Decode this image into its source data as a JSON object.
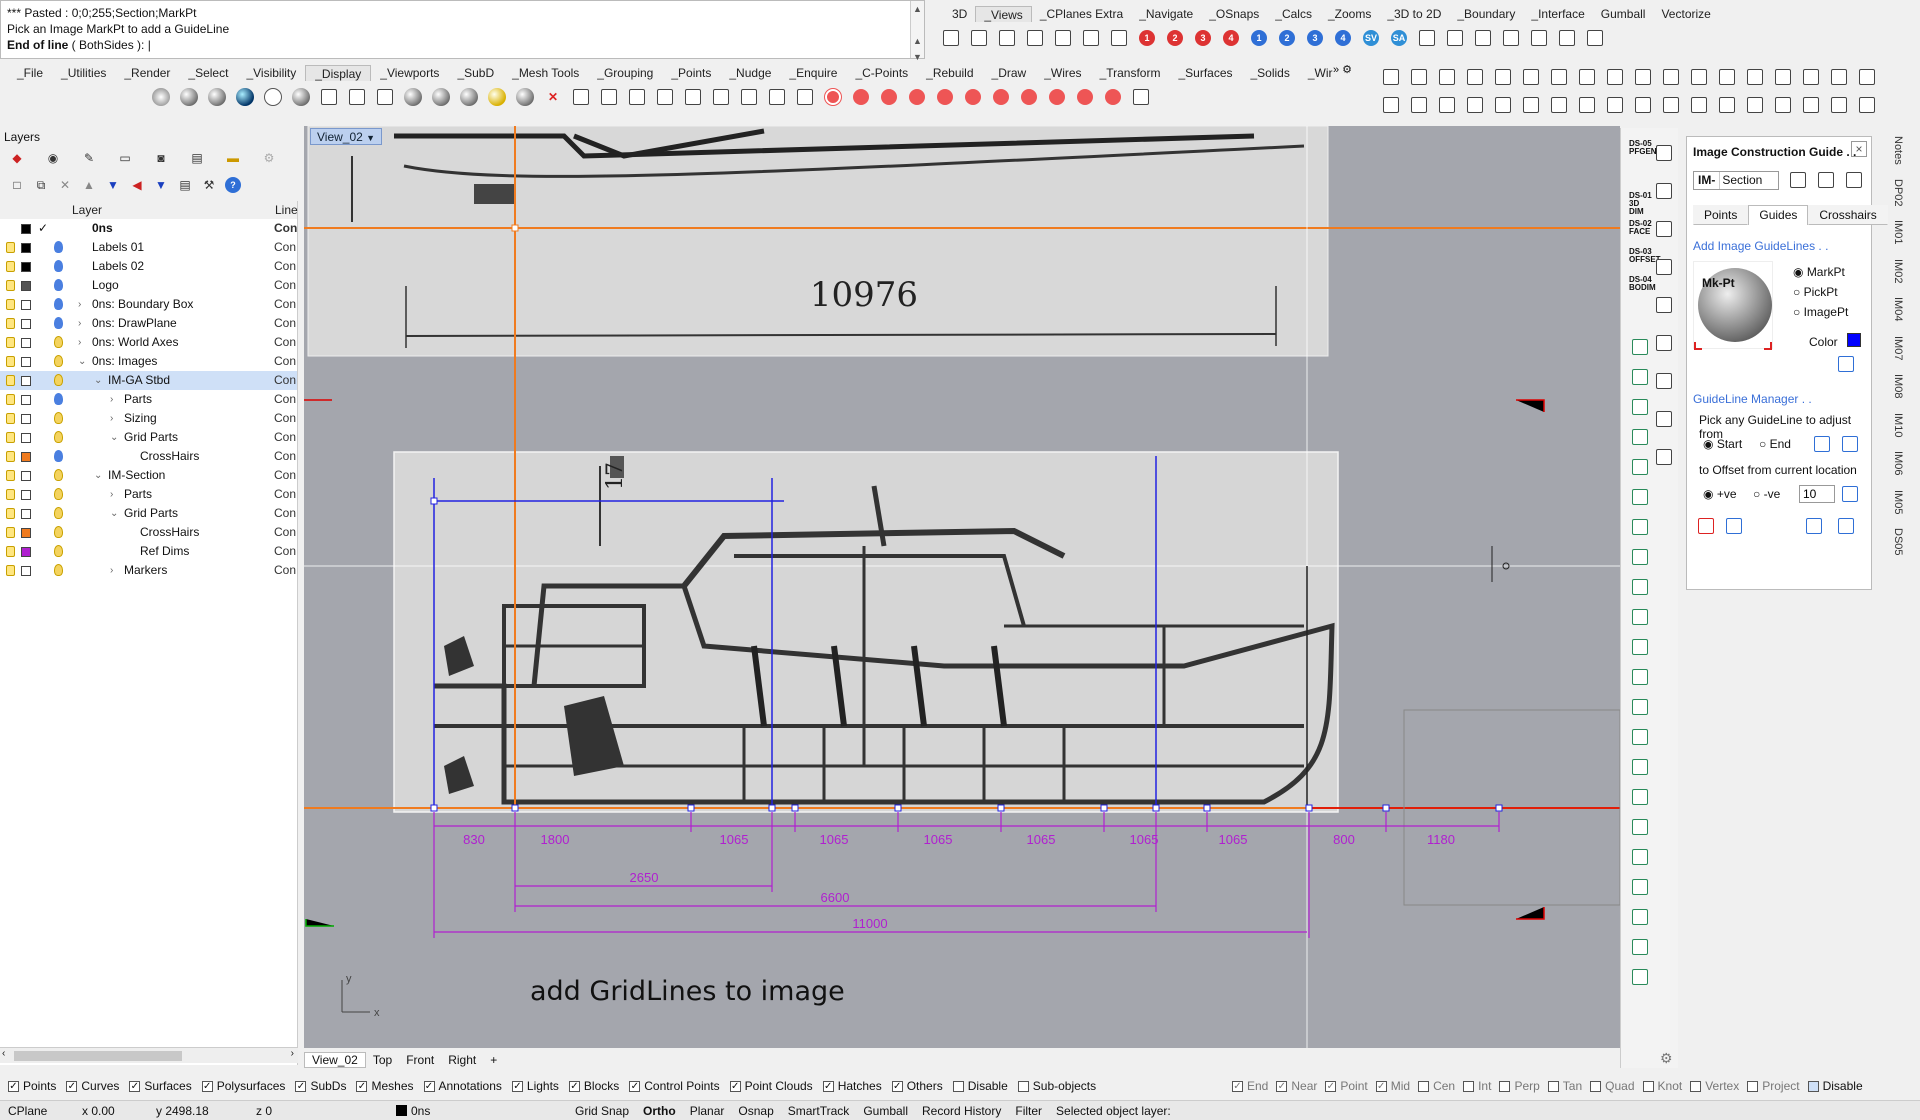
{
  "command": {
    "line1": "*** Pasted : 0;0;255;Section;MarkPt",
    "line2": "Pick an Image MarkPt to add a GuideLine",
    "line3_bold": "End of line",
    "line3_rest": " ( BothSides ):"
  },
  "top_tabs": [
    "3D",
    "_Views",
    "_CPlanes Extra",
    "_Navigate",
    "_OSnaps",
    "_Calcs",
    "_Zooms",
    "_3D to 2D",
    "_Boundary",
    "_Interface",
    "Gumball",
    "Vectorize"
  ],
  "main_tabs": [
    "_File",
    "_Utilities",
    "_Render",
    "_Select",
    "_Visibility",
    "_Display",
    "_Viewports",
    "_SubD",
    "_Mesh Tools",
    "_Grouping",
    "_Points",
    "_Nudge",
    "_Enquire",
    "_C-Points",
    "_Rebuild",
    "_Draw",
    "_Wires",
    "_Transform",
    "_Surfaces",
    "_Solids",
    "_Wir"
  ],
  "layers": {
    "title": "Layers",
    "col_layer": "Layer",
    "col_line": "Line",
    "rows": [
      {
        "name": "0ns",
        "line": "Con",
        "bold": true,
        "indent": 0
      },
      {
        "name": "Labels 01",
        "line": "Con",
        "indent": 0
      },
      {
        "name": "Labels 02",
        "line": "Con",
        "indent": 0
      },
      {
        "name": "Logo",
        "line": "Con",
        "indent": 0
      },
      {
        "name": "0ns: Boundary Box",
        "line": "Con",
        "indent": 0,
        "exp": ">"
      },
      {
        "name": "0ns: DrawPlane",
        "line": "Con",
        "indent": 0,
        "exp": ">"
      },
      {
        "name": "0ns: World Axes",
        "line": "Con",
        "indent": 0,
        "exp": ">"
      },
      {
        "name": "0ns: Images",
        "line": "Con",
        "indent": 0,
        "exp": "v"
      },
      {
        "name": "IM-GA Stbd",
        "line": "Con",
        "indent": 1,
        "exp": "v",
        "selected": true
      },
      {
        "name": "Parts",
        "line": "Con",
        "indent": 2,
        "exp": ">"
      },
      {
        "name": "Sizing",
        "line": "Con",
        "indent": 2,
        "exp": ">"
      },
      {
        "name": "Grid Parts",
        "line": "Con",
        "indent": 2,
        "exp": "v"
      },
      {
        "name": "CrossHairs",
        "line": "Con",
        "indent": 3
      },
      {
        "name": "IM-Section",
        "line": "Con",
        "indent": 1,
        "exp": "v"
      },
      {
        "name": "Parts",
        "line": "Con",
        "indent": 2,
        "exp": ">"
      },
      {
        "name": "Grid Parts",
        "line": "Con",
        "indent": 2,
        "exp": "v"
      },
      {
        "name": "CrossHairs",
        "line": "Con",
        "indent": 3
      },
      {
        "name": "Ref Dims",
        "line": "Con",
        "indent": 3
      },
      {
        "name": "Markers",
        "line": "Con",
        "indent": 2,
        "exp": ">"
      }
    ]
  },
  "viewport": {
    "title": "View_02",
    "top_dim": "10976",
    "top_small_dim": "17",
    "caption": "add GridLines to image",
    "axis_y": "y",
    "axis_x": "x",
    "dims_row1": [
      "830",
      "1800",
      "1065",
      "1065",
      "1065",
      "1065",
      "1065",
      "1065",
      "800",
      "1180"
    ],
    "dim_2650": "2650",
    "dim_6600": "6600",
    "dim_11000": "11000"
  },
  "view_tabs": [
    "View_02",
    "Top",
    "Front",
    "Right",
    "+"
  ],
  "filters": [
    {
      "label": "Points",
      "checked": true
    },
    {
      "label": "Curves",
      "checked": true
    },
    {
      "label": "Surfaces",
      "checked": true
    },
    {
      "label": "Polysurfaces",
      "checked": true
    },
    {
      "label": "SubDs",
      "checked": true
    },
    {
      "label": "Meshes",
      "checked": true
    },
    {
      "label": "Annotations",
      "checked": true
    },
    {
      "label": "Lights",
      "checked": true
    },
    {
      "label": "Blocks",
      "checked": true
    },
    {
      "label": "Control Points",
      "checked": true
    },
    {
      "label": "Point Clouds",
      "checked": true
    },
    {
      "label": "Hatches",
      "checked": true
    },
    {
      "label": "Others",
      "checked": true
    },
    {
      "label": "Disable",
      "checked": false
    },
    {
      "label": "Sub-objects",
      "checked": false
    }
  ],
  "osnaps": [
    "End",
    "Near",
    "Point",
    "Mid",
    "Cen",
    "Int",
    "Perp",
    "Tan",
    "Quad",
    "Knot",
    "Vertex",
    "Project",
    "Disable"
  ],
  "status": {
    "cplane": "CPlane",
    "x": "x 0.00",
    "y": "y 2498.18",
    "z": "z 0",
    "layer": "0ns",
    "items": [
      "Grid Snap",
      "Ortho",
      "Planar",
      "Osnap",
      "SmartTrack",
      "Gumball",
      "Record History",
      "Filter",
      "Selected object layer:"
    ]
  },
  "right_labels": [
    "DS-05 PFGEN",
    "DS-01 3D DIM",
    "DS-02 FACE",
    "DS-03 OFFSET",
    "DS-04 BODIM"
  ],
  "icg": {
    "title": "Image Construction Guide . .",
    "prefix": "IM-",
    "section": "Section",
    "tabs": [
      "Points",
      "Guides",
      "Crosshairs"
    ],
    "add_title": "Add Image GuideLines . .",
    "mkpt": "Mk-Pt",
    "opt_markpt": "MarkPt",
    "opt_pickpt": "PickPt",
    "opt_imagept": "ImagePt",
    "color_label": "Color",
    "color": "#0000ff",
    "mgr_title": "GuideLine Manager . .",
    "pick_text": "Pick any GuideLine to adjust from",
    "start": "Start",
    "end": "End",
    "offset_text": "to Offset from current location",
    "pos": "+ve",
    "neg": "-ve",
    "offset_val": "10"
  },
  "vtabs": [
    "Notes",
    "DP02",
    "IM01",
    "IM02",
    "IM04",
    "IM07",
    "IM08",
    "IM10",
    "IM06",
    "IM05",
    "DS05"
  ]
}
